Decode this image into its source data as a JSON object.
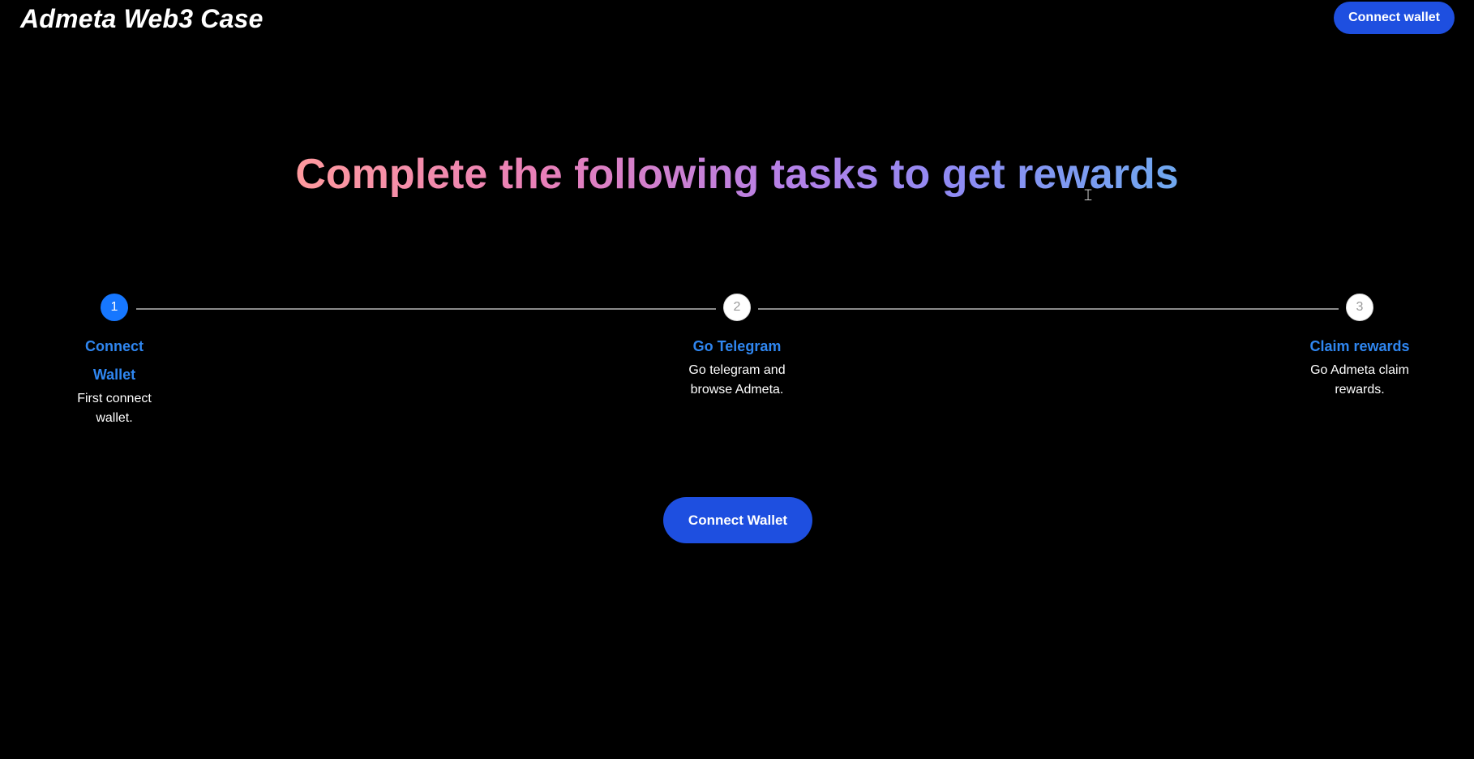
{
  "header": {
    "brand": "Admeta Web3 Case",
    "connect_label": "Connect wallet"
  },
  "hero": {
    "headline": "Complete the following tasks to get rewards"
  },
  "steps": [
    {
      "number": "1",
      "title": "Connect Wallet",
      "description": "First connect wallet.",
      "state": "active"
    },
    {
      "number": "2",
      "title": "Go Telegram",
      "description": "Go telegram and browse Admeta.",
      "state": "pending"
    },
    {
      "number": "3",
      "title": "Claim rewards",
      "description": "Go Admeta claim rewards.",
      "state": "pending"
    }
  ],
  "action": {
    "connect_label": "Connect Wallet"
  },
  "colors": {
    "background": "#000000",
    "button": "#1e4fe0",
    "active_step": "#1677ff",
    "step_title": "#2f86f0"
  },
  "icons": {
    "cursor": "text-cursor-icon"
  }
}
